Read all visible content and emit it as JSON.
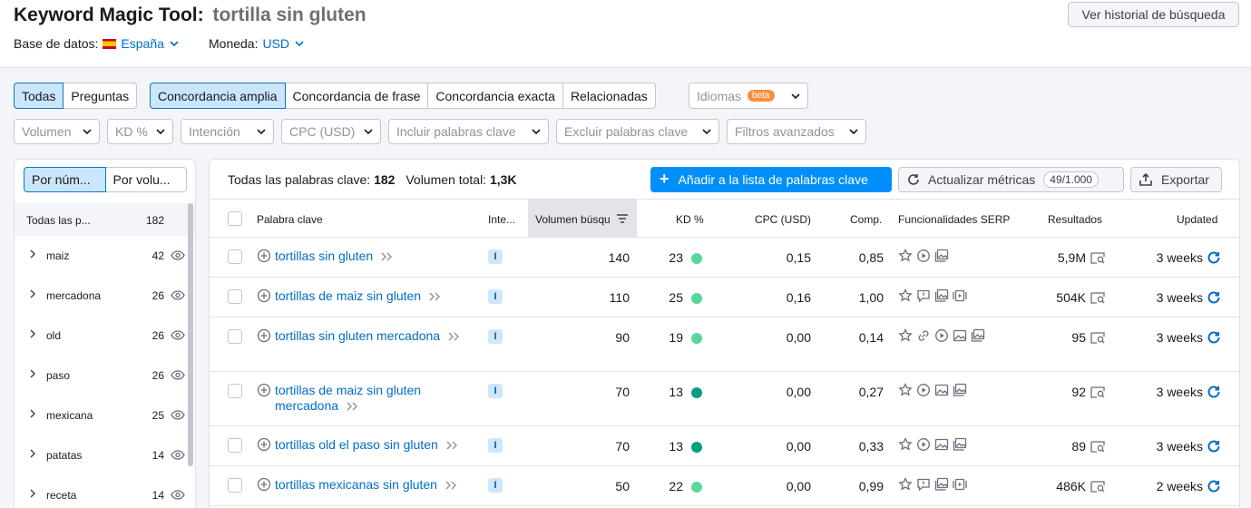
{
  "header": {
    "title": "Keyword Magic Tool:",
    "query": "tortilla sin gluten",
    "history_button": "Ver historial de búsqueda",
    "db_label": "Base de datos:",
    "db_value": "España",
    "currency_label": "Moneda:",
    "currency_value": "USD"
  },
  "tabs": {
    "all": "Todas",
    "questions": "Preguntas",
    "broad": "Concordancia amplia",
    "phrase": "Concordancia de frase",
    "exact": "Concordancia exacta",
    "related": "Relacionadas",
    "languages": "Idiomas",
    "beta": "beta"
  },
  "filters": {
    "volume": "Volumen",
    "kd": "KD %",
    "intent": "Intención",
    "cpc": "CPC (USD)",
    "include": "Incluir palabras clave",
    "exclude": "Excluir palabras clave",
    "advanced": "Filtros avanzados"
  },
  "sidebar": {
    "seg_number": "Por núm...",
    "seg_volume": "Por volu...",
    "all_label": "Todas las p...",
    "all_count": "182",
    "groups": [
      {
        "name": "maiz",
        "count": "42"
      },
      {
        "name": "mercadona",
        "count": "26"
      },
      {
        "name": "old",
        "count": "26"
      },
      {
        "name": "paso",
        "count": "26"
      },
      {
        "name": "mexicana",
        "count": "25"
      },
      {
        "name": "patatas",
        "count": "14"
      },
      {
        "name": "receta",
        "count": "14"
      }
    ]
  },
  "toolbar": {
    "all_keywords_label": "Todas las palabras clave:",
    "all_keywords_value": "182",
    "total_volume_label": "Volumen total:",
    "total_volume_value": "1,3K",
    "add_button": "Añadir a la lista de palabras clave",
    "update_button": "Actualizar métricas",
    "update_quota": "49/1.000",
    "export_button": "Exportar"
  },
  "columns": {
    "keyword": "Palabra clave",
    "intent": "Inte...",
    "volume": "Volumen búsqu",
    "kd": "KD %",
    "cpc": "CPC (USD)",
    "comp": "Comp.",
    "serp": "Funcionalidades SERP",
    "results": "Resultados",
    "updated": "Updated"
  },
  "colors": {
    "accent": "#008ff8",
    "link": "#006dca",
    "kd_light": "#59d69e",
    "kd_dark": "#009f81"
  },
  "rows": [
    {
      "keyword": "tortillas sin gluten",
      "intent": "I",
      "volume": "140",
      "kd": "23",
      "kd_level": "light",
      "cpc": "0,15",
      "comp": "0,85",
      "serp": [
        "star-icon",
        "video-icon",
        "image-pack-icon"
      ],
      "results": "5,9M",
      "updated": "3 weeks"
    },
    {
      "keyword": "tortillas de maiz sin gluten",
      "intent": "I",
      "volume": "110",
      "kd": "25",
      "kd_level": "light",
      "cpc": "0,16",
      "comp": "1,00",
      "serp": [
        "star-icon",
        "faq-icon",
        "image-pack-icon",
        "video-carousel-icon"
      ],
      "results": "504K",
      "updated": "3 weeks"
    },
    {
      "keyword": "tortillas sin gluten mercadona",
      "intent": "I",
      "volume": "90",
      "kd": "19",
      "kd_level": "light",
      "cpc": "0,00",
      "comp": "0,14",
      "serp": [
        "star-icon",
        "link-icon",
        "video-icon",
        "image-icon",
        "image-pack-icon"
      ],
      "results": "95",
      "updated": "3 weeks"
    },
    {
      "keyword": "tortillas de maiz sin gluten mercadona",
      "intent": "I",
      "volume": "70",
      "kd": "13",
      "kd_level": "dark",
      "cpc": "0,00",
      "comp": "0,27",
      "serp": [
        "star-icon",
        "video-icon",
        "image-icon",
        "image-pack-icon"
      ],
      "results": "92",
      "updated": "3 weeks"
    },
    {
      "keyword": "tortillas old el paso sin gluten",
      "intent": "I",
      "volume": "70",
      "kd": "13",
      "kd_level": "dark",
      "cpc": "0,00",
      "comp": "0,33",
      "serp": [
        "star-icon",
        "video-icon",
        "image-icon",
        "image-pack-icon"
      ],
      "results": "89",
      "updated": "3 weeks"
    },
    {
      "keyword": "tortillas mexicanas sin gluten",
      "intent": "I",
      "volume": "50",
      "kd": "22",
      "kd_level": "light",
      "cpc": "0,00",
      "comp": "0,99",
      "serp": [
        "star-icon",
        "faq-icon",
        "image-pack-icon",
        "video-carousel-icon"
      ],
      "results": "486K",
      "updated": "2 weeks"
    }
  ]
}
